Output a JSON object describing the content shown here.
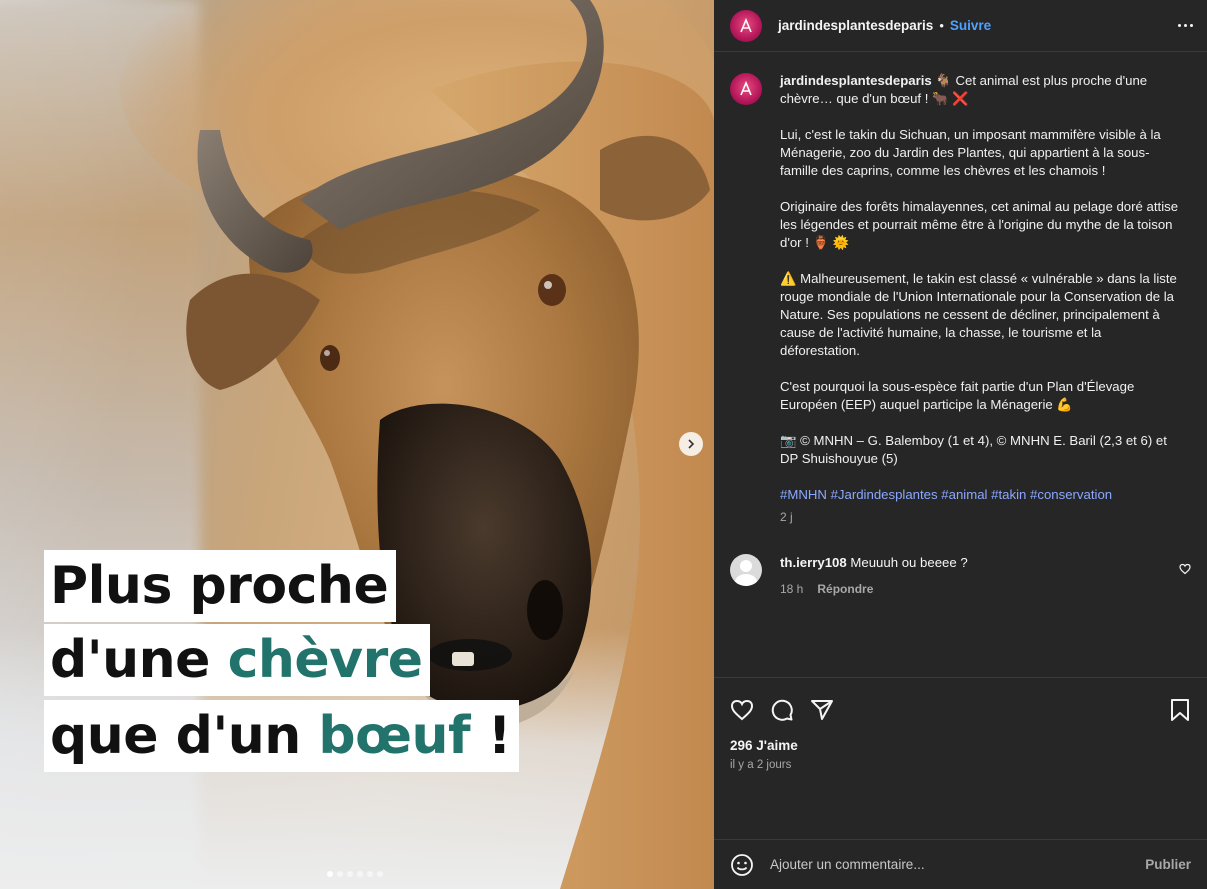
{
  "header": {
    "username": "jardindesplantesdeparis",
    "separator": "•",
    "follow_label": "Suivre"
  },
  "media": {
    "caption_lines": [
      {
        "text": "Plus proche"
      },
      {
        "pre": "d'une ",
        "accent": "chèvre"
      },
      {
        "pre": "que d'un ",
        "accent": "bœuf",
        "post": " !"
      }
    ],
    "slide_count": 6,
    "active_slide": 1,
    "accent_color": "#21736b"
  },
  "caption": {
    "username": "jardindesplantesdeparis",
    "intro": "🐐 Cet animal est plus proche d'une chèvre… que d'un bœuf ! 🐂 ❌",
    "paragraphs": [
      "Lui, c'est le takin du Sichuan, un imposant mammifère visible à la Ménagerie, zoo du Jardin des Plantes, qui appartient à la sous-famille des caprins, comme les chèvres et les chamois !",
      "Originaire des forêts himalayennes, cet animal au pelage doré attise les légendes et pourrait même être à l'origine du mythe de la toison d'or ! 🏺 🌞",
      "⚠️ Malheureusement, le takin est classé « vulnérable » dans la liste rouge mondiale de l'Union Internationale pour la Conservation de la Nature. Ses populations ne cessent de décliner, principalement à cause de l'activité humaine, la chasse, le tourisme et la déforestation.",
      "C'est pourquoi la sous-espèce fait partie d'un Plan d'Élevage Européen (EEP) auquel participe la Ménagerie 💪",
      "📷 © MNHN – G. Balemboy (1 et 4), © MNHN E. Baril (2,3 et 6) et DP Shuishouyue (5)"
    ],
    "hashtags": [
      "#MNHN",
      "#Jardindesplantes",
      "#animal",
      "#takin",
      "#conservation"
    ],
    "time": "2 j"
  },
  "comments": [
    {
      "username": "th.ierry108",
      "text": "Meuuuh ou beeee ?",
      "time": "18 h",
      "reply_label": "Répondre"
    }
  ],
  "actions": {
    "likes": "296 J'aime",
    "posted_ago": "il y a 2 jours"
  },
  "add_comment": {
    "placeholder": "Ajouter un commentaire...",
    "publish_label": "Publier"
  },
  "icons": [
    "heart-icon",
    "comment-icon",
    "share-icon",
    "bookmark-icon",
    "emoji-icon",
    "more-icon",
    "chevron-right-icon"
  ],
  "colors": {
    "link": "#4ea1ff",
    "hashtag": "#8aa8ff",
    "panel_bg": "#262626"
  }
}
